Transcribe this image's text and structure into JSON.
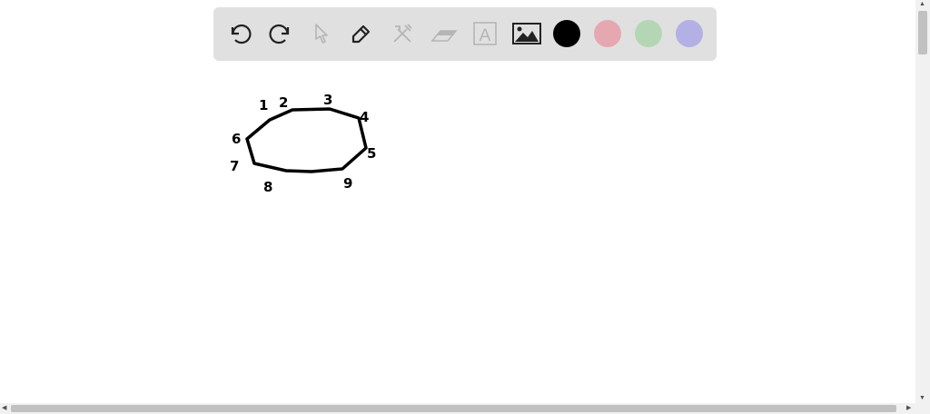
{
  "toolbar": {
    "tools": [
      {
        "name": "undo",
        "icon": "undo-icon",
        "enabled": true
      },
      {
        "name": "redo",
        "icon": "redo-icon",
        "enabled": true
      },
      {
        "name": "select",
        "icon": "pointer-icon",
        "enabled": false
      },
      {
        "name": "pen",
        "icon": "pen-icon",
        "enabled": true
      },
      {
        "name": "tools",
        "icon": "tools-icon",
        "enabled": false
      },
      {
        "name": "eraser",
        "icon": "eraser-icon",
        "enabled": false
      },
      {
        "name": "text",
        "icon": "text-icon",
        "enabled": false
      },
      {
        "name": "image",
        "icon": "image-icon",
        "enabled": true
      }
    ],
    "text_tool_letter": "A",
    "colors": [
      "#000000",
      "#e6a8b0",
      "#b5d6b5",
      "#b3b0e6"
    ]
  },
  "drawing": {
    "labels": [
      "1",
      "2",
      "3",
      "4",
      "5",
      "6",
      "7",
      "8",
      "9"
    ]
  }
}
